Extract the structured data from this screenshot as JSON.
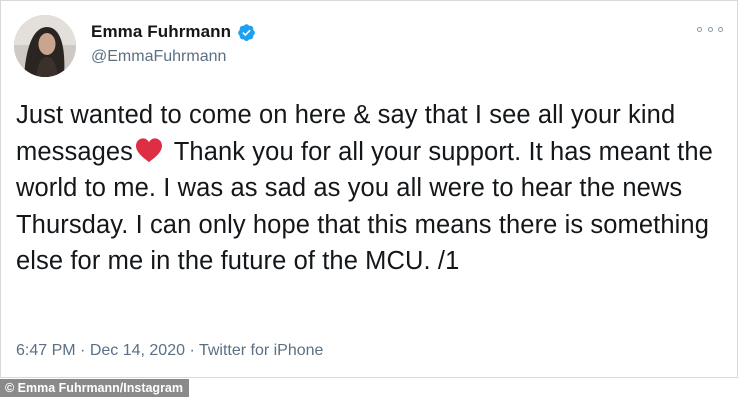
{
  "author": {
    "display_name": "Emma Fuhrmann",
    "handle": "@EmmaFuhrmann",
    "verified": true
  },
  "tweet": {
    "text_before_heart": "Just wanted to come on here & say that I see all your kind messages",
    "emoji": "red-heart",
    "text_after_heart": " Thank you for all your support. It has meant the world to me. I was as sad as you all were to hear the news Thursday. I can only hope that this means there is something else for me in the future of the MCU. /1",
    "time": "6:47 PM",
    "date": "Dec 14, 2020",
    "source": "Twitter for iPhone",
    "separator": " · "
  },
  "caption": "© Emma Fuhrmann/Instagram",
  "colors": {
    "verified": "#1da1f2",
    "heart": "#dd2e44",
    "secondary_text": "#5b7083",
    "caption_bg": "#8a8a8a"
  }
}
